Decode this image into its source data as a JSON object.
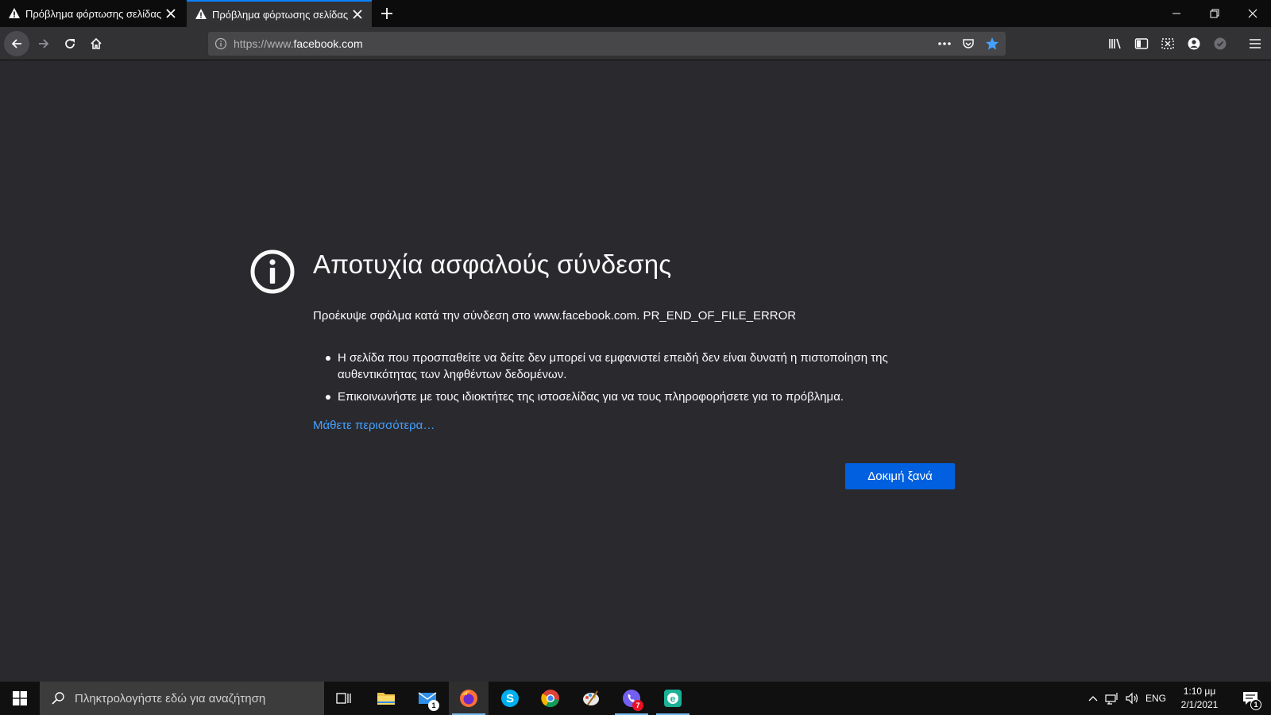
{
  "browser": {
    "tabs": [
      {
        "title": "Πρόβλημα φόρτωσης σελίδας",
        "active": false
      },
      {
        "title": "Πρόβλημα φόρτωσης σελίδας",
        "active": true
      }
    ],
    "url_prefix": "https://www.",
    "url_domain": "facebook.com",
    "accent_color": "#0a84ff"
  },
  "error_page": {
    "title": "Αποτυχία ασφαλούς σύνδεσης",
    "description": "Προέκυψε σφάλμα κατά την σύνδεση στο www.facebook.com. PR_END_OF_FILE_ERROR",
    "bullets": [
      "Η σελίδα που προσπαθείτε να δείτε δεν μπορεί να εμφανιστεί επειδή δεν είναι δυνατή η πιστοποίηση της αυθεντικότητας των ληφθέντων δεδομένων.",
      "Επικοινωνήστε με τους ιδιοκτήτες της ιστοσελίδας για να τους πληροφορήσετε για το πρόβλημα."
    ],
    "learn_more": "Μάθετε περισσότερα…",
    "retry_button": "Δοκιμή ξανά",
    "button_color": "#0060df",
    "link_color": "#45a1ff"
  },
  "taskbar": {
    "search_placeholder": "Πληκτρολογήστε εδώ για αναζήτηση",
    "mail_badge": "1",
    "viber_badge": "7",
    "language": "ENG",
    "time": "1:10 μμ",
    "date": "2/1/2021",
    "notifications_count": "1"
  }
}
